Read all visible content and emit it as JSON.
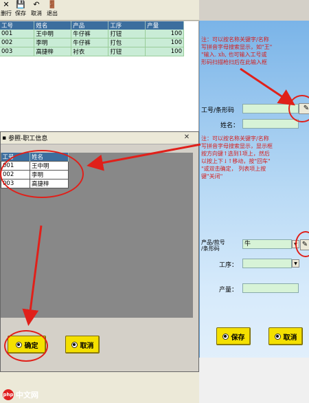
{
  "toolbar": {
    "items": [
      {
        "label": "删行",
        "icon": "close-x-icon"
      },
      {
        "label": "保存",
        "icon": "save-icon"
      },
      {
        "label": "取消",
        "icon": "cancel-icon"
      },
      {
        "label": "退出",
        "icon": "exit-icon"
      }
    ]
  },
  "main_grid": {
    "headers": [
      "工号",
      "姓名",
      "产品",
      "工序",
      "产量"
    ],
    "rows": [
      [
        "001",
        "王中明",
        "牛仔裤",
        "打钮",
        "100"
      ],
      [
        "002",
        "李明",
        "牛仔裤",
        "打包",
        "100"
      ],
      [
        "003",
        "高捷梓",
        "衬衣",
        "打钮",
        "100"
      ]
    ]
  },
  "right_panel": {
    "note1": "注：可以按名称关键字/名称\n写拼音字母搜索显示，如\"王\"\n\"输入. xh, 也可输入工号或\n形码扫描枪扫后在此输入框",
    "employee_code_label": "工号/条形码",
    "name_label": "姓名：",
    "note2": "注：可以按名称关键字/名称\n写拼音字母搜索显示，显示框\n按方向键↑选到1项上，然后\n以按上下↓↑移动，按\"回车\"\n\"或双击确定，  列表项上按\n键\"关闭\"",
    "product_label": "产品/款号\n/条形码",
    "product_value": "牛",
    "process_label": "工序：",
    "output_label": "产量：",
    "save_label": "保存",
    "cancel_label": "取消"
  },
  "dialog": {
    "title": "参照-职工信息",
    "headers": [
      "工号",
      "姓名"
    ],
    "rows": [
      [
        "001",
        "王中明"
      ],
      [
        "002",
        "李明"
      ],
      [
        "003",
        "高捷梓"
      ]
    ],
    "ok_label": "确定",
    "cancel_label": "取消"
  },
  "watermark": {
    "logo_text": "php",
    "text": "中文网"
  },
  "colors": {
    "annotation": "#e0201a",
    "grid_header": "#3c6e9e",
    "grid_row": "#c9ecd6",
    "button": "#f4e000",
    "field": "#d7f3d7"
  }
}
